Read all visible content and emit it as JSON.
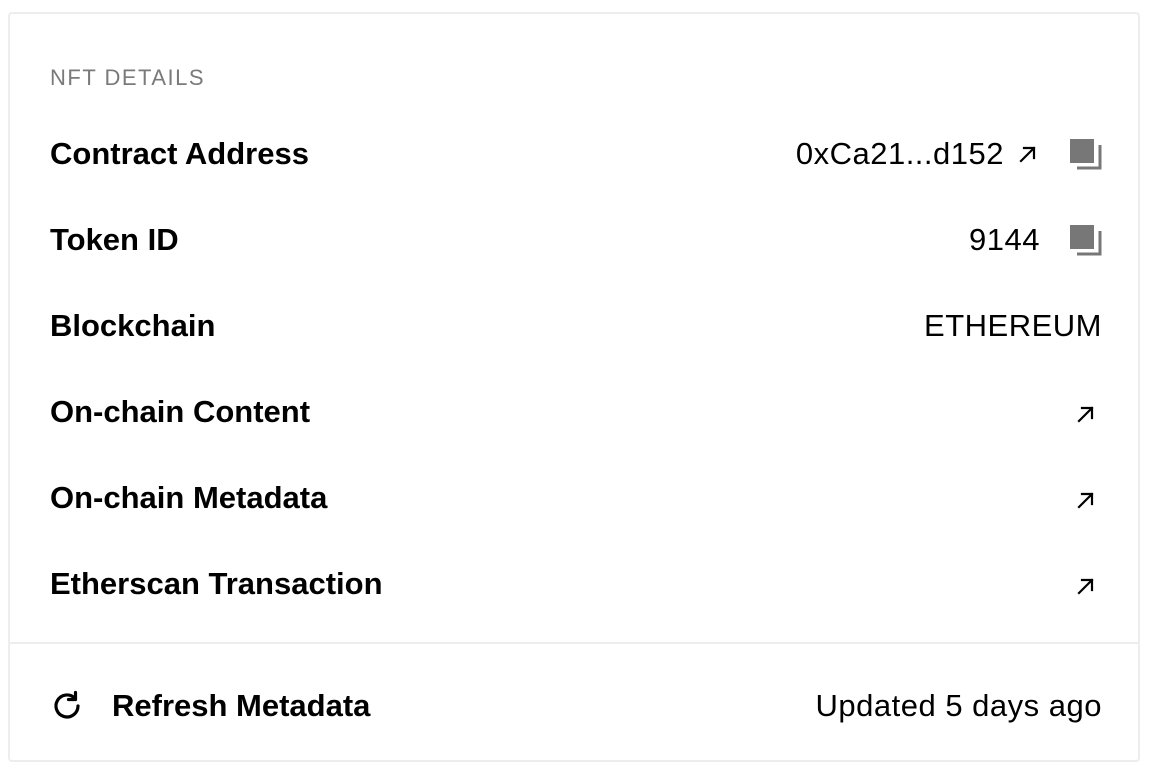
{
  "section_title": "NFT DETAILS",
  "rows": [
    {
      "label": "Contract Address",
      "value": "0xCa21...d152",
      "link_icon": "arrow-up-right-icon",
      "copy_icon": "copy-icon"
    },
    {
      "label": "Token ID",
      "value": "9144",
      "copy_icon": "copy-icon"
    },
    {
      "label": "Blockchain",
      "value": "ETHEREUM"
    },
    {
      "label": "On-chain Content",
      "link_icon": "arrow-up-right-icon"
    },
    {
      "label": "On-chain Metadata",
      "link_icon": "arrow-up-right-icon"
    },
    {
      "label": "Etherscan Transaction",
      "link_icon": "arrow-up-right-icon"
    }
  ],
  "footer": {
    "refresh_label": "Refresh Metadata",
    "refresh_icon": "refresh-icon",
    "updated_text": "Updated 5 days ago"
  },
  "colors": {
    "border": "#ededed",
    "muted_text": "#7a7a7a",
    "icon_gray": "#777777",
    "text": "#000000"
  }
}
